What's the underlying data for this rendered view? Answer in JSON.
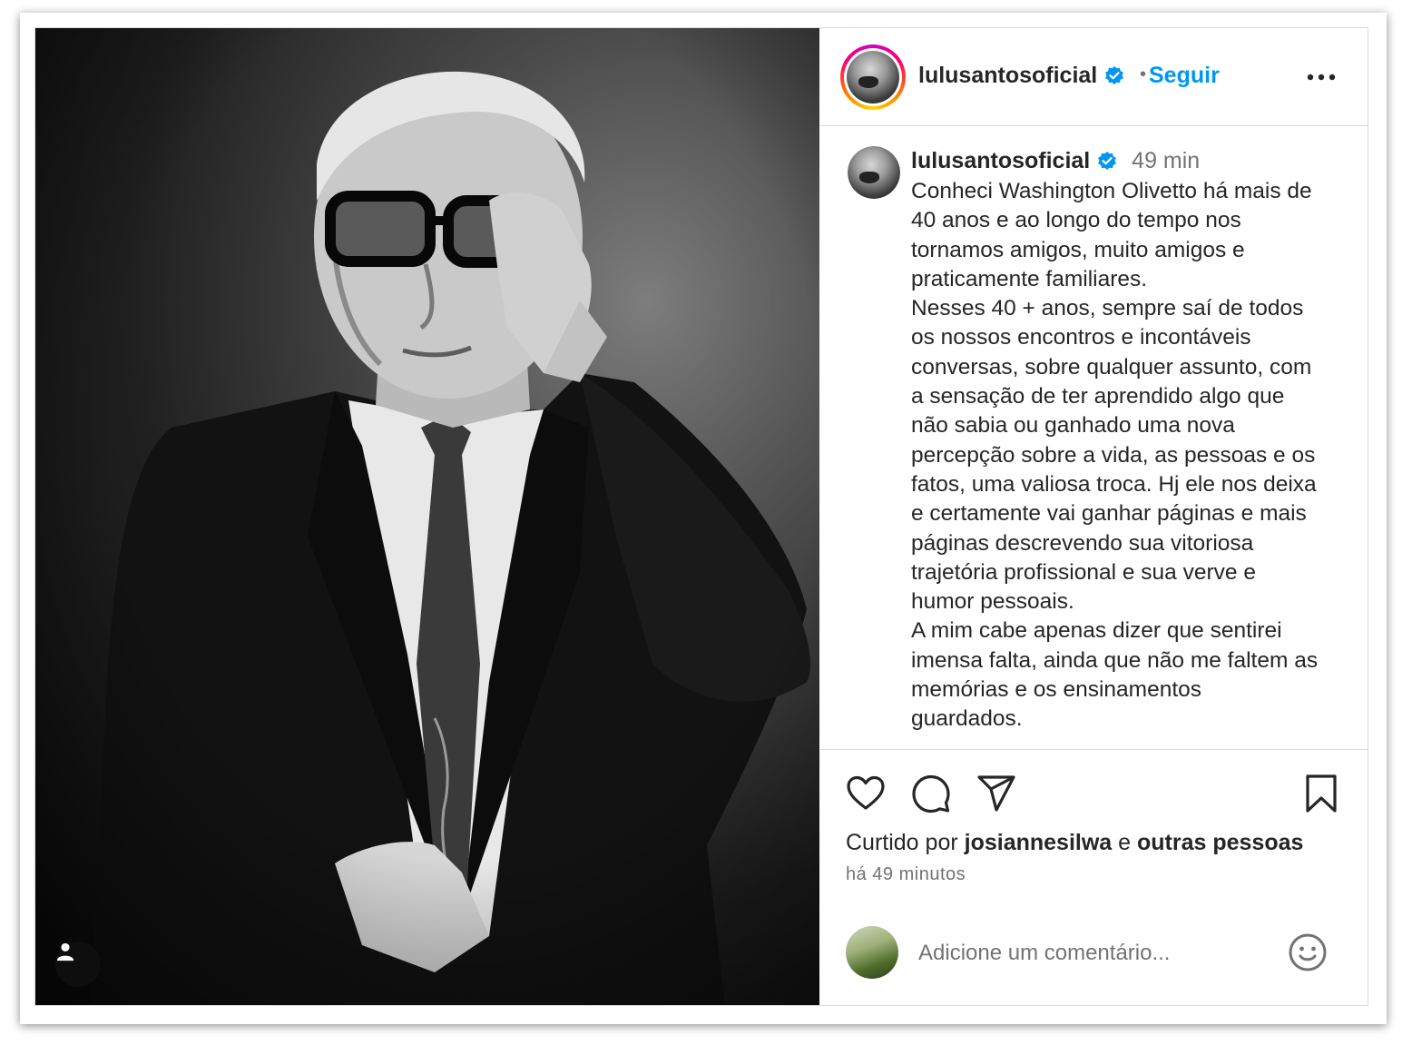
{
  "header": {
    "username": "lulusantosoficial",
    "separator": "•",
    "follow_label": "Seguir"
  },
  "caption": {
    "username": "lulusantosoficial",
    "time": "49 min",
    "text": "Conheci Washington Olivetto há mais de\n40 anos e ao longo do tempo nos\ntornamos amigos, muito amigos e\npraticamente familiares.\nNesses 40 + anos, sempre saí de todos\nos nossos encontros e incontáveis\nconversas, sobre qualquer assunto, com\na sensação de ter aprendido algo que\nnão sabia ou ganhado uma nova\npercepção sobre a vida, as pessoas e os\nfatos, uma valiosa troca. Hj ele nos deixa\ne certamente vai ganhar páginas e mais\npáginas descrevendo sua vitoriosa\ntrajetória profissional e sua verve e\nhumor pessoais.\nA mim cabe apenas dizer que sentirei\nimensa falta, ainda que não me faltem as\nmemórias e os ensinamentos\nguardados."
  },
  "likes": {
    "prefix": "Curtido por",
    "user": "josiannesilwa",
    "joiner": "e",
    "others": "outras pessoas"
  },
  "posted_ago": "há 49 minutos",
  "comment": {
    "placeholder": "Adicione um comentário..."
  },
  "colors": {
    "accent": "#0095f6",
    "verified": "#0095f6",
    "text": "#262626",
    "muted": "#737373",
    "border": "#dbdbdb"
  },
  "icons": [
    "verified-badge-icon",
    "more-options-icon",
    "heart-icon",
    "comment-icon",
    "share-icon",
    "bookmark-icon",
    "emoji-icon",
    "user-tag-icon"
  ]
}
